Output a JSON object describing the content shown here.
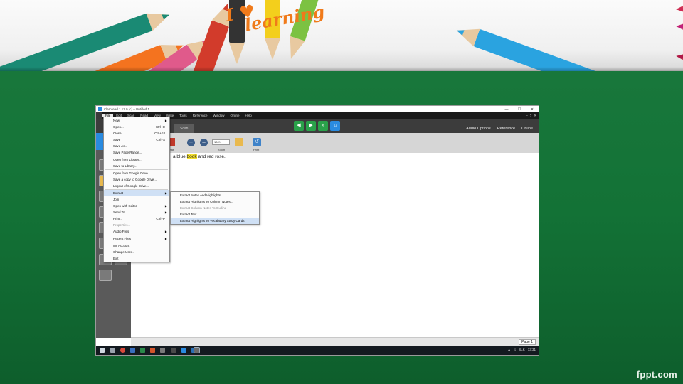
{
  "banner": {
    "title_line1": "I ♥",
    "title_line2": "learning"
  },
  "watermark": "fppt.com",
  "window": {
    "title": "Claroread 1.17.0 (c) – Untitled 1",
    "controls": [
      "—",
      "☐",
      "✕"
    ]
  },
  "menubar": {
    "items": [
      "File",
      "Edit",
      "Scan",
      "Read",
      "View",
      "Write",
      "Tools",
      "Reference",
      "Window",
      "Online",
      "Help"
    ],
    "right_glyphs": [
      "–",
      "?",
      "✕"
    ]
  },
  "ribbon": {
    "tab_label": "Scan",
    "right_links": [
      "Audio Options",
      "Reference",
      "Online"
    ],
    "toolbar_labels": {
      "format": "rmat",
      "zoom": "Zoom",
      "print": "Print"
    },
    "zoom_value": "100%"
  },
  "document": {
    "before": "a blue ",
    "highlight": "book",
    "after": " and red  rose."
  },
  "status": {
    "page": "Page 1"
  },
  "taskbar": {
    "lang": "SLK",
    "time": "13:31"
  },
  "file_menu": [
    {
      "label": "New",
      "arrow": true
    },
    {
      "label": "Open...",
      "shortcut": "Ctrl+O"
    },
    {
      "label": "Close",
      "shortcut": "Ctrl+F4"
    },
    {
      "label": "Save",
      "shortcut": "Ctrl+S"
    },
    {
      "label": "Save As..."
    },
    {
      "label": "Save Page Range...",
      "sep_after": true
    },
    {
      "label": "Open from Library..."
    },
    {
      "label": "Save to Library...",
      "sep_after": true
    },
    {
      "label": "Open from Google Drive..."
    },
    {
      "label": "Save a copy to Google Drive..."
    },
    {
      "label": "Logout of Google Drive...",
      "sep_after": true
    },
    {
      "label": "Extract",
      "arrow": true,
      "highlight": true
    },
    {
      "label": "Join"
    },
    {
      "label": "Open with Editor",
      "arrow": true
    },
    {
      "label": "Send To",
      "arrow": true
    },
    {
      "label": "Print...",
      "shortcut": "Ctrl+P"
    },
    {
      "label": "Properties...",
      "dim": true
    },
    {
      "label": "Audio Files",
      "arrow": true,
      "sep_after": true
    },
    {
      "label": "Recent Files",
      "arrow": true,
      "sep_after": true
    },
    {
      "label": "My Account"
    },
    {
      "label": "Change User..."
    },
    {
      "label": "Exit"
    }
  ],
  "extract_submenu": [
    {
      "label": "Extract Notes And Highlights..."
    },
    {
      "label": "Extract Highlights To Column Notes..."
    },
    {
      "label": "Extract Column Notes To Outline",
      "dim": true
    },
    {
      "label": "Extract Text..."
    },
    {
      "label": "Extract Highlights To Vocabulary Study Cards",
      "highlight": true
    }
  ],
  "colors": {
    "slide_green": "#1b7a3e",
    "menu_highlight": "#cfe0f5",
    "text_highlight": "#f5e12c",
    "accent_blue": "#2a8be0"
  }
}
